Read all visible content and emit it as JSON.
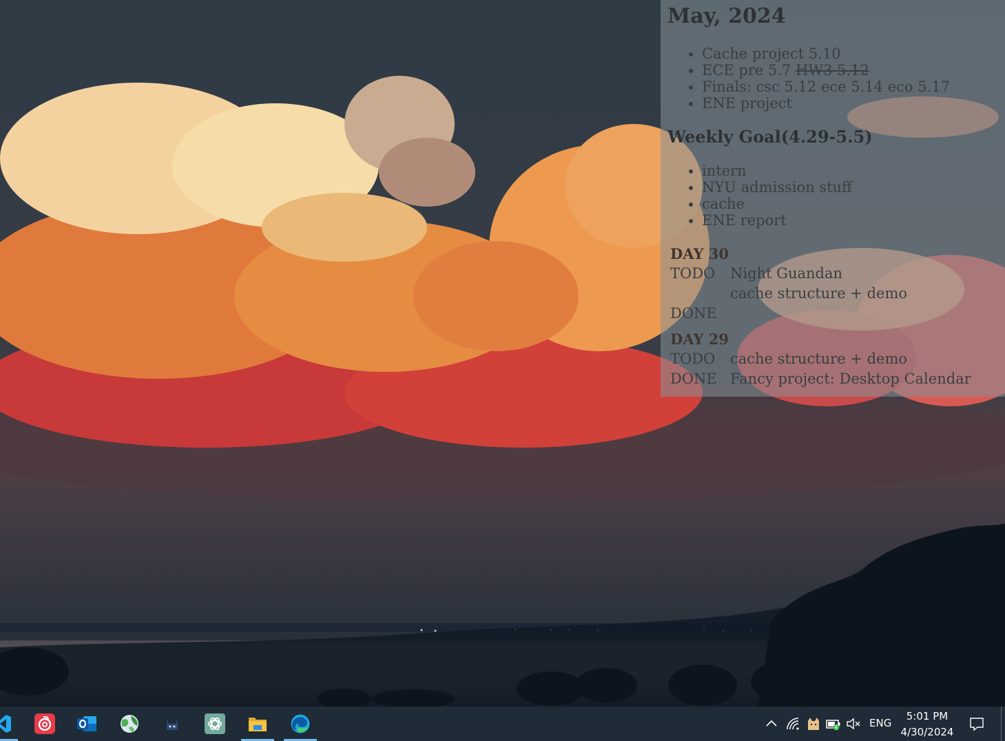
{
  "calendar": {
    "month_title": "May, 2024",
    "month_goals": [
      {
        "text": "Cache project 5.10"
      },
      {
        "text": "ECE pre 5.7 ",
        "struck": "HW3 5.12"
      },
      {
        "text": "Finals: csc 5.12 ece 5.14 eco 5.17"
      },
      {
        "text": "ENE project"
      }
    ],
    "week_title": "Weekly Goal(4.29-5.5)",
    "week_goals": [
      "intern",
      "NYU admission stuff",
      "cache",
      "ENE report"
    ],
    "days": [
      {
        "title": "DAY 30",
        "todo_label": "TODO",
        "todo": [
          "Night Guandan",
          "cache structure + demo"
        ],
        "done_label": "DONE",
        "done": []
      },
      {
        "title": "DAY 29",
        "todo_label": "TODO",
        "todo": [
          "cache structure + demo"
        ],
        "done_label": "DONE",
        "done": [
          "Fancy project: Desktop Calendar"
        ]
      }
    ]
  },
  "taskbar": {
    "apps": [
      {
        "name": "vscode-icon",
        "color": "#23a9f2",
        "active": true
      },
      {
        "name": "netease-music-icon",
        "color": "#e83c4a",
        "active": false
      },
      {
        "name": "outlook-icon",
        "color": "#1a78d4",
        "active": false
      },
      {
        "name": "globe-app-icon",
        "color": "#4caf50",
        "active": false
      },
      {
        "name": "cat-app-icon",
        "color": "#2d4a73",
        "active": false
      },
      {
        "name": "chatgpt-icon",
        "color": "#74aa9c",
        "active": false
      },
      {
        "name": "file-explorer-icon",
        "color": "#f6c342",
        "active": true
      },
      {
        "name": "edge-icon",
        "color": "#1fa8e0",
        "active": true
      }
    ],
    "tray": {
      "icons": [
        "chevron-up-icon",
        "wifi-icon",
        "cat-tray-icon",
        "battery-charging-icon",
        "volume-muted-icon"
      ],
      "language": "ENG",
      "time": "5:01 PM",
      "date": "4/30/2024"
    }
  }
}
